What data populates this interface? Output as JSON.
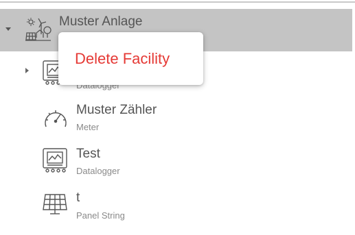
{
  "tree": {
    "root": {
      "title": "Muster Anlage",
      "icon": "facility-icon",
      "expanded": true
    },
    "children": [
      {
        "title": "",
        "subtitle": "Datalogger",
        "icon": "datalogger-icon",
        "expandable": true
      },
      {
        "title": "Muster Zähler",
        "subtitle": "Meter",
        "icon": "meter-icon"
      },
      {
        "title": "Test",
        "subtitle": "Datalogger",
        "icon": "datalogger-icon"
      },
      {
        "title": "t",
        "subtitle": "Panel String",
        "icon": "solar-panel-icon"
      }
    ]
  },
  "context_menu": {
    "items": [
      {
        "label": "Delete Facility",
        "color": "#e53935"
      }
    ]
  },
  "colors": {
    "selected_row_bg": "#c4c4c4",
    "danger": "#e53935"
  }
}
